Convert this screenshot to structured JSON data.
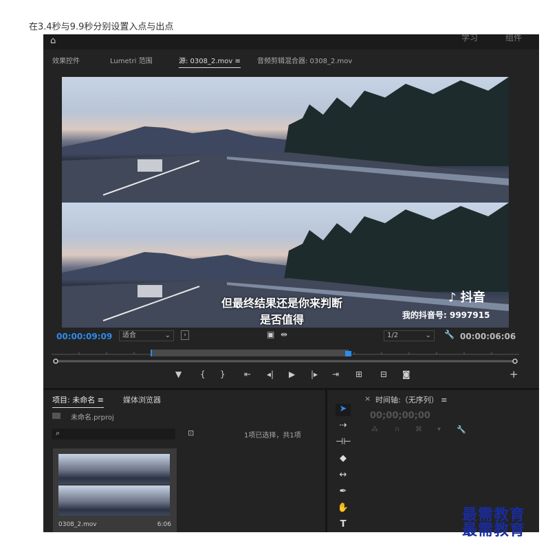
{
  "caption": "在3.4秒与9.9秒分别设置入点与出点",
  "topbar": {
    "workspace_learn": "学习",
    "workspace_assembly": "组件"
  },
  "panel_tabs": {
    "effect_controls": "效果控件",
    "lumetri_scopes": "Lumetri 范围",
    "source": "源: 0308_2.mov",
    "audio_mixer": "音频剪辑混合器: 0308_2.mov"
  },
  "video": {
    "subtitle_line1": "但最终结果还是你来判断",
    "subtitle_line2": "是否值得",
    "tiktok_logo": "抖音",
    "tiktok_id": "我的抖音号: 9997915"
  },
  "source_controls": {
    "current_timecode": "00:00:09:09",
    "fit_dropdown": "适合",
    "resolution_dropdown": "1/2",
    "duration_timecode": "00:00:06:06"
  },
  "transport": {
    "marker_icon": "marker-icon",
    "in_point_icon": "mark-in-icon",
    "out_point_icon": "mark-out-icon",
    "go_to_in_icon": "go-to-in-icon",
    "step_back_icon": "step-back-icon",
    "play_icon": "play-icon",
    "step_forward_icon": "step-forward-icon",
    "go_to_out_icon": "go-to-out-icon",
    "insert_icon": "insert-icon",
    "overwrite_icon": "overwrite-icon",
    "export_frame_icon": "camera-icon",
    "add_button": "+"
  },
  "project_panel": {
    "tab_project": "项目: 未命名",
    "tab_media_browser": "媒体浏览器",
    "project_file": "未命名.prproj",
    "selection_status": "1项已选择，共1项",
    "clip_name": "0308_2.mov",
    "clip_duration": "6:06"
  },
  "timeline_panel": {
    "close": "×",
    "title": "时间轴:（无序列）",
    "timecode": "00;00;00;00"
  },
  "watermark": "最需教育"
}
